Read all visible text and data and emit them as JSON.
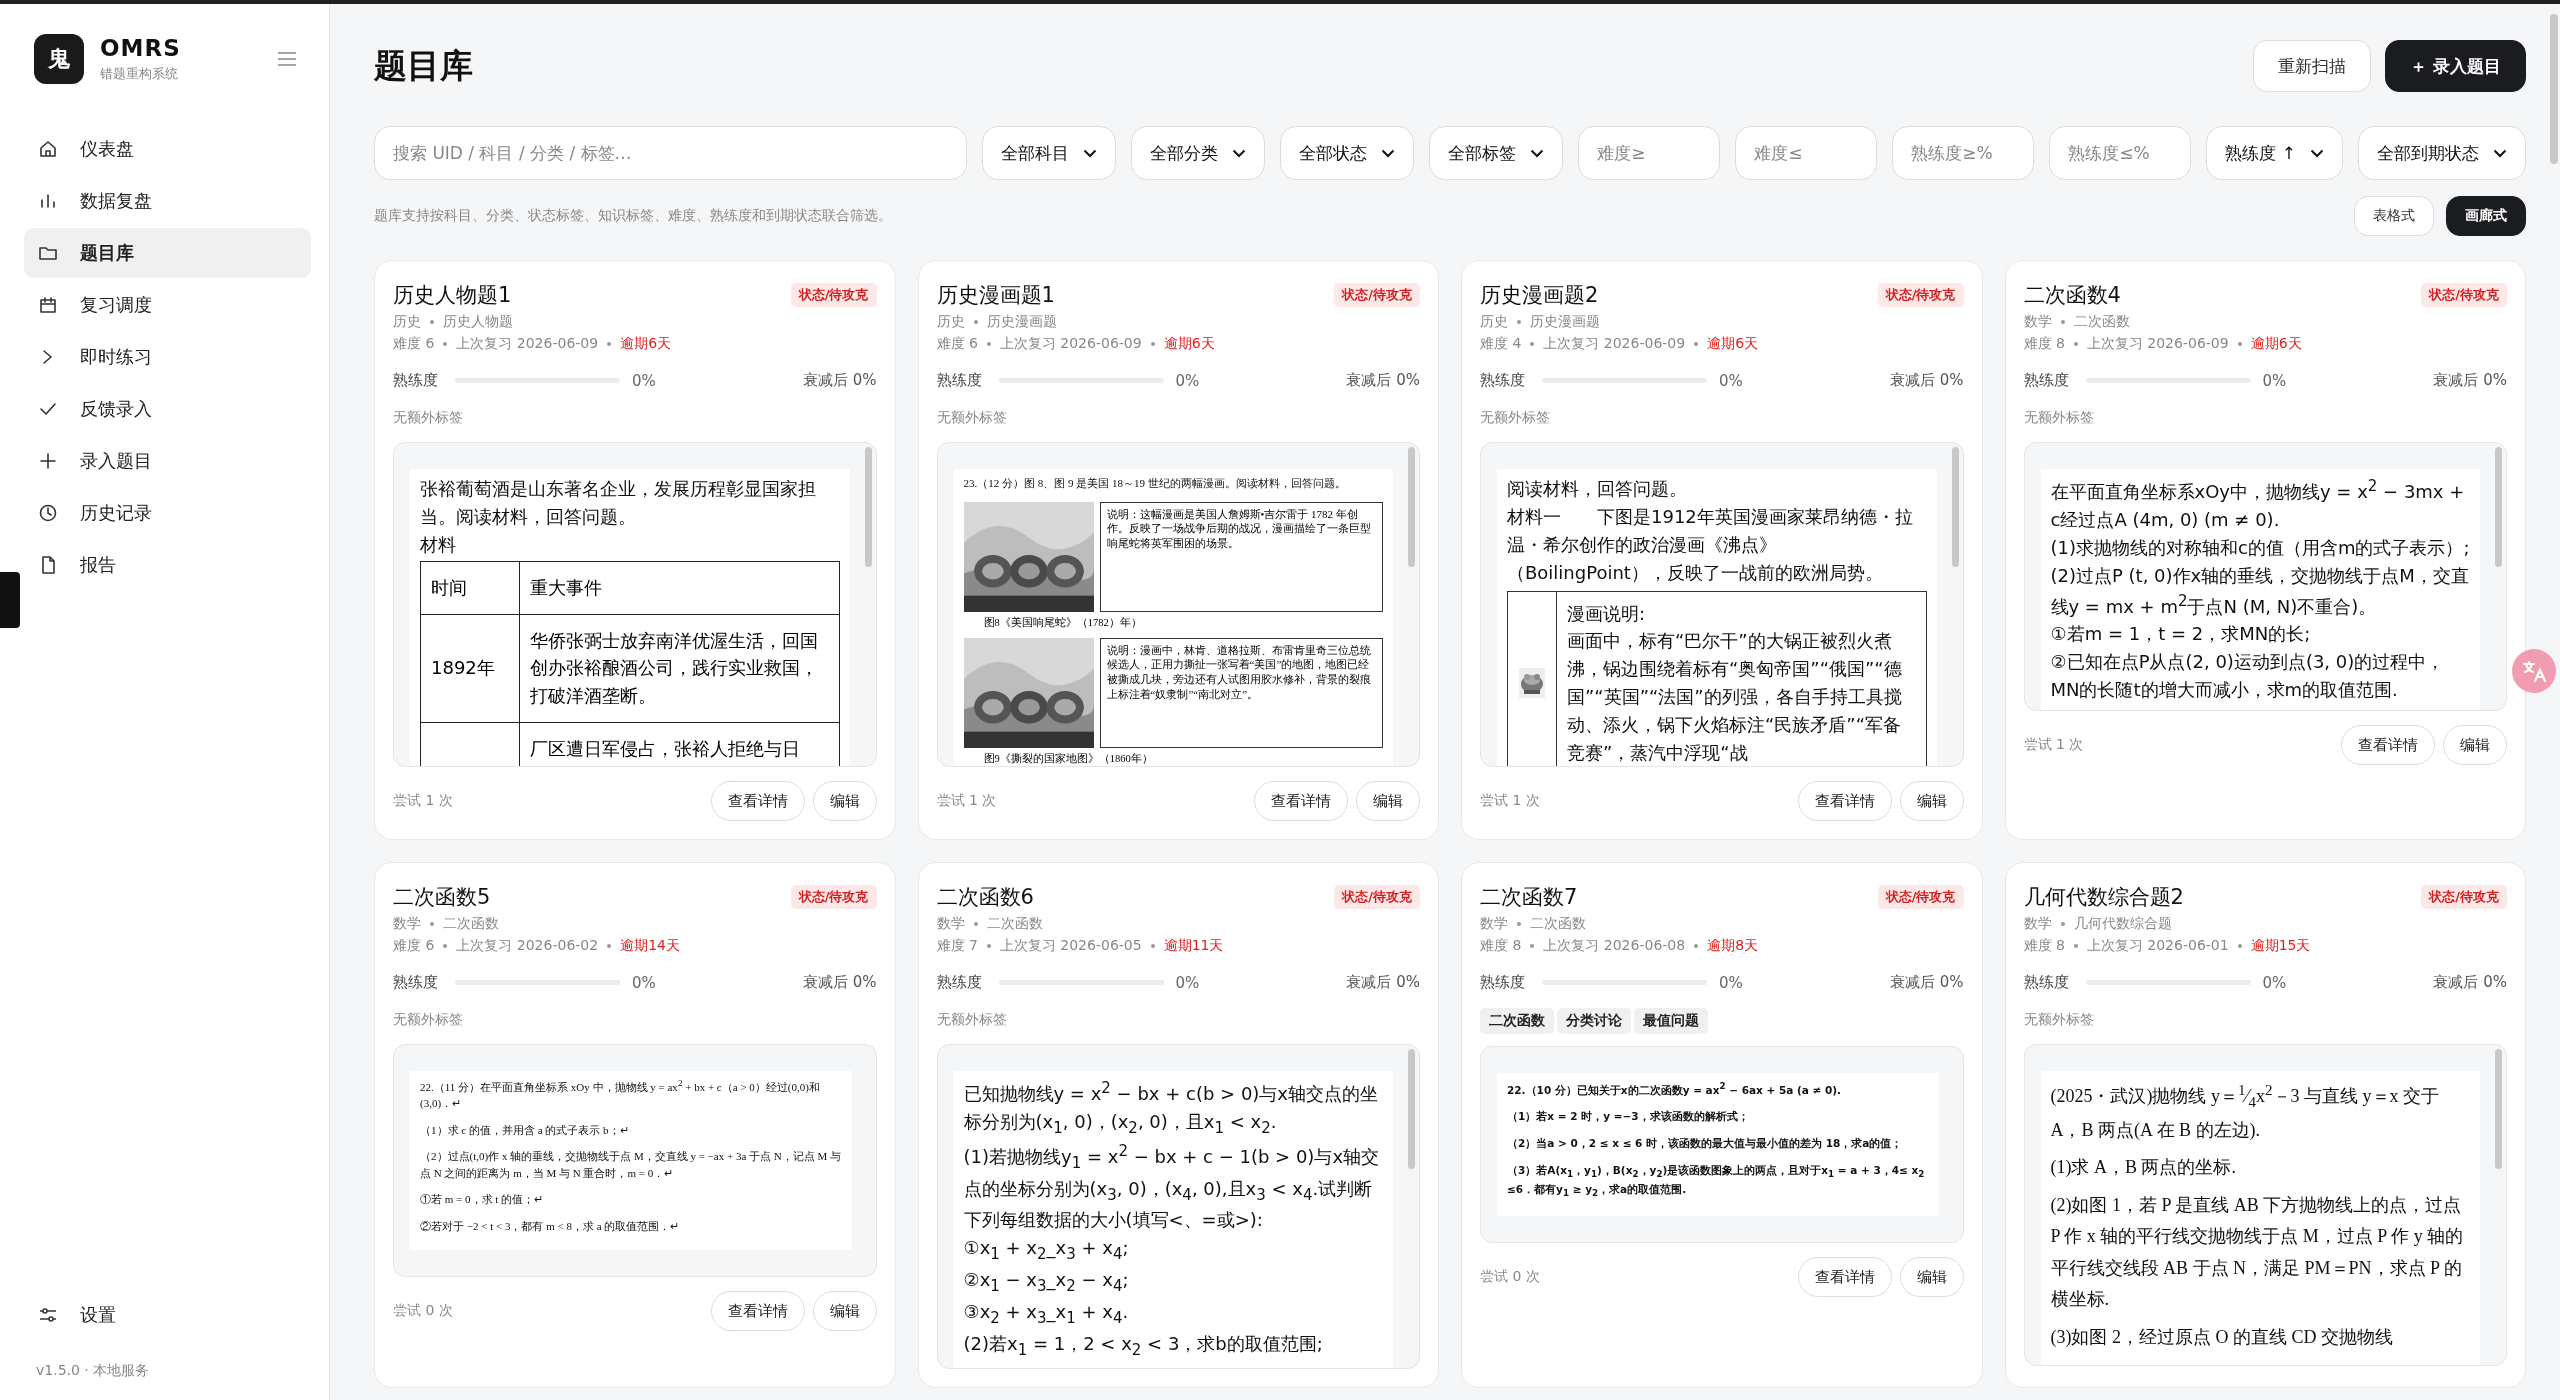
{
  "sidebar": {
    "logo": "鬼",
    "app_name": "OMRS",
    "app_subtitle": "错题重构系统",
    "items": [
      {
        "label": "仪表盘",
        "selected": false
      },
      {
        "label": "数据复盘",
        "selected": false
      },
      {
        "label": "题目库",
        "selected": true
      },
      {
        "label": "复习调度",
        "selected": false
      },
      {
        "label": "即时练习",
        "selected": false
      },
      {
        "label": "反馈录入",
        "selected": false
      },
      {
        "label": "录入题目",
        "selected": false
      },
      {
        "label": "历史记录",
        "selected": false
      },
      {
        "label": "报告",
        "selected": false
      }
    ],
    "settings": "设置",
    "version": "v1.5.0 · 本地服务"
  },
  "header": {
    "title": "题目库",
    "buttons": [
      {
        "label": "重新扫描",
        "kind": "secondary"
      },
      {
        "label": "＋ 录入题目",
        "kind": "primary"
      }
    ]
  },
  "filters": {
    "search": {
      "placeholder": "搜索 UID / 科目 / 分类 / 标签…"
    },
    "controls": [
      {
        "kind": "select",
        "value": "全部科目"
      },
      {
        "kind": "select",
        "value": "全部分类"
      },
      {
        "kind": "select",
        "value": "全部状态"
      },
      {
        "kind": "select",
        "value": "全部标签"
      },
      {
        "kind": "input",
        "placeholder": "难度≥"
      },
      {
        "kind": "input",
        "placeholder": "难度≤"
      },
      {
        "kind": "input",
        "placeholder": "熟练度≥%"
      },
      {
        "kind": "input",
        "placeholder": "熟练度≤%"
      },
      {
        "kind": "select",
        "value": "熟练度 ↑"
      },
      {
        "kind": "select",
        "value": "全部到期状态"
      }
    ]
  },
  "hint": "题库支持按科目、分类、状态标签、知识标签、难度、熟练度和到期状态联合筛选。",
  "view_toggle": [
    {
      "label": "表格式",
      "selected": false
    },
    {
      "label": "画廊式",
      "selected": true
    }
  ],
  "cards": [
    {
      "title": "历史人物题1",
      "badge": "状态/待攻克",
      "subject": "历史",
      "category": "历史人物题",
      "difficulty": "难度 6",
      "last_review": "上次复习 2026-06-09",
      "overdue": "逾期6天",
      "mastery_label": "熟练度",
      "level": 0,
      "mastery": "0%",
      "decayed": "衰减后 0%",
      "no_tags": "无额外标签",
      "preview": {
        "kind": "text",
        "scrollable": true,
        "blocks": [
          {
            "kind": "p",
            "text": "张裕葡萄酒是山东著名企业，发展历程彰显国家担当。阅读材料，回答问题。"
          },
          {
            "kind": "p",
            "text": "材料"
          },
          {
            "kind": "table",
            "rows": [
              [
                "时间",
                "重大事件"
              ],
              [
                "1892年",
                "华侨张弼士放弃南洋优渥生活，回国创办张裕酿酒公司，践行实业救国，打破洋酒垄断。"
              ],
              [
                "",
                "厂区遭日军侵占，张裕人拒绝与日"
              ]
            ]
          }
        ]
      },
      "attempts": "尝试 1 次",
      "actions": [
        "查看详情",
        "编辑"
      ]
    },
    {
      "title": "历史漫画题1",
      "badge": "状态/待攻克",
      "subject": "历史",
      "category": "历史漫画题",
      "difficulty": "难度 6",
      "last_review": "上次复习 2026-06-09",
      "overdue": "逾期6天",
      "mastery_label": "熟练度",
      "level": 0,
      "mastery": "0%",
      "decayed": "衰减后 0%",
      "no_tags": "无额外标签",
      "preview": {
        "kind": "scan",
        "scrollable": true,
        "blocks": [
          {
            "kind": "p",
            "text": "23.（12 分）图 8、图 9 是美国 18～19 世纪的两幅漫画。阅读材料，回答问题。"
          },
          {
            "kind": "figure",
            "note": "说明：这幅漫画是美国人詹姆斯•吉尔雷于 1782 年创作。反映了一场战争后期的战况，漫画描绘了一条巨型响尾蛇将英军围困的场景。",
            "caption": "图8《美国响尾蛇》（1782）年）"
          },
          {
            "kind": "figure",
            "note": "说明：漫画中，林肯、道格拉斯、布雷肯里奇三位总统候选人，正用力撕扯一张写着“美国”的地图，地图已经被撕成几块，旁边还有人试图用胶水修补，背景的裂痕上标注着“奴隶制”“南北对立”。",
            "caption": "图9《撕裂的国家地图》（1860年）"
          }
        ]
      },
      "attempts": "尝试 1 次",
      "actions": [
        "查看详情",
        "编辑"
      ]
    },
    {
      "title": "历史漫画题2",
      "badge": "状态/待攻克",
      "subject": "历史",
      "category": "历史漫画题",
      "difficulty": "难度 4",
      "last_review": "上次复习 2026-06-09",
      "overdue": "逾期6天",
      "mastery_label": "熟练度",
      "level": 0,
      "mastery": "0%",
      "decayed": "衰减后 0%",
      "no_tags": "无额外标签",
      "preview": {
        "kind": "text",
        "scrollable": true,
        "blocks": [
          {
            "kind": "p",
            "text": "阅读材料，回答问题。"
          },
          {
            "kind": "p",
            "text": "材料一　　下图是1912年英国漫画家莱昂纳德・拉温・希尔创作的政治漫画《沸点》（BoilingPoint），反映了一战前的欧洲局势。"
          },
          {
            "kind": "captioned_picture",
            "lines": [
              "漫画说明:",
              "画面中，标有“巴尔干”的大锅正被烈火煮沸，锅边围绕着标有“奥匈帝国”“俄国”“德国”“英国”“法国”的列强，各自手持工具搅动、添火，锅下火焰标注“民族矛盾”“军备竞赛”，蒸汽中浮现“战"
            ]
          }
        ]
      },
      "attempts": "尝试 1 次",
      "actions": [
        "查看详情",
        "编辑"
      ]
    },
    {
      "title": "二次函数4",
      "badge": "状态/待攻克",
      "subject": "数学",
      "category": "二次函数",
      "difficulty": "难度 8",
      "last_review": "上次复习 2026-06-09",
      "overdue": "逾期6天",
      "mastery_label": "熟练度",
      "level": 0,
      "mastery": "0%",
      "decayed": "衰减后 0%",
      "no_tags": "无额外标签",
      "preview": {
        "kind": "text",
        "scrollable": true,
        "blocks": [
          {
            "kind": "p",
            "text": "在平面直角坐标系xOy中，抛物线y = x$^{2}$ − 3mx + c经过点A (4m, 0) (m ≠ 0)."
          },
          {
            "kind": "p",
            "text": "(1)求抛物线的对称轴和c的值（用含m的式子表示）;"
          },
          {
            "kind": "p",
            "text": "(2)过点P (t, 0)作x轴的垂线，交抛物线于点M，交直线y = mx + m$^{2}$于点N (M, N)不重合)。"
          },
          {
            "kind": "p",
            "text": "①若m = 1，t = 2，求MN的长;"
          },
          {
            "kind": "p",
            "text": "②已知在点P从点(2, 0)运动到点(3, 0)的过程中，MN的长随t的增大而减小，求m的取值范围."
          }
        ]
      },
      "attempts": "尝试 1 次",
      "actions": [
        "查看详情",
        "编辑"
      ]
    },
    {
      "title": "二次函数5",
      "badge": "状态/待攻克",
      "subject": "数学",
      "category": "二次函数",
      "difficulty": "难度 6",
      "last_review": "上次复习 2026-06-02",
      "overdue": "逾期14天",
      "mastery_label": "熟练度",
      "level": 0,
      "mastery": "0%",
      "decayed": "衰减后 0%",
      "no_tags": "无额外标签",
      "preview": {
        "kind": "scan",
        "scrollable": false,
        "blocks": [
          {
            "kind": "p",
            "text": "22.（11 分）在平面直角坐标系 xOy 中，抛物线 y = ax$^{2}$ + bx + c（a > 0）经过(0,0)和(3,0)．↵"
          },
          {
            "kind": "p",
            "text": "（1）求 c 的值，并用含 a 的式子表示 b；↵"
          },
          {
            "kind": "p",
            "text": "（2）过点(t,0)作 x 轴的垂线，交抛物线于点 M，交直线 y = −ax + 3a 于点 N，记点 M 与点 N 之间的距离为 m，当 M 与 N 重合时，m = 0．↵"
          },
          {
            "kind": "p",
            "text": "①若 m = 0，求 t 的值；↵"
          },
          {
            "kind": "p",
            "text": "②若对于 −2 < t < 3，都有 m < 8，求 a 的取值范围．↵"
          }
        ]
      },
      "attempts": "尝试 0 次",
      "actions": [
        "查看详情",
        "编辑"
      ]
    },
    {
      "title": "二次函数6",
      "badge": "状态/待攻克",
      "subject": "数学",
      "category": "二次函数",
      "difficulty": "难度 7",
      "last_review": "上次复习 2026-06-05",
      "overdue": "逾期11天",
      "mastery_label": "熟练度",
      "level": 0,
      "mastery": "0%",
      "decayed": "衰减后 0%",
      "no_tags": "无额外标签",
      "preview": {
        "kind": "text",
        "scrollable": true,
        "blocks": [
          {
            "kind": "p",
            "text": "已知抛物线y = x$^{2}$ − bx + c(b > 0)与x轴交点的坐标分别为(x$_{1}$, 0)，(x$_{2}$, 0)，且x$_{1}$ < x$_{2}$."
          },
          {
            "kind": "p",
            "text": "(1)若抛物线y$_{1}$ = x$^{2}$ − bx + c − 1(b > 0)与x轴交点的坐标分别为(x$_{3}$, 0)，(x$_{4}$, 0),且x$_{3}$ < x$_{4}$.试判断下列每组数据的大小(填写<、=或>):"
          },
          {
            "kind": "p",
            "text": "①x$_{1}$ + x$_{2}$_x$_{3}$ + x$_{4}$;"
          },
          {
            "kind": "p",
            "text": "②x$_{1}$ − x$_{3}$_x$_{2}$ − x$_{4}$;"
          },
          {
            "kind": "p",
            "text": "③x$_{2}$ + x$_{3}$_x$_{1}$ + x$_{4}$."
          },
          {
            "kind": "p",
            "text": "(2)若x$_{1}$ = 1，2 < x$_{2}$ < 3，求b的取值范围;"
          }
        ]
      }
    },
    {
      "title": "二次函数7",
      "badge": "状态/待攻克",
      "subject": "数学",
      "category": "二次函数",
      "difficulty": "难度 8",
      "last_review": "上次复习 2026-06-08",
      "overdue": "逾期8天",
      "mastery_label": "熟练度",
      "level": 0,
      "mastery": "0%",
      "decayed": "衰减后 0%",
      "tags": [
        "二次函数",
        "分类讨论",
        "最值问题"
      ],
      "preview": {
        "kind": "scan_bold",
        "scrollable": false,
        "blocks": [
          {
            "kind": "p",
            "text": "22.（10 分）已知关于x的二次函数y = ax$^{2}$ − 6ax + 5a (a ≠ 0)."
          },
          {
            "kind": "p",
            "text": "（1）若x = 2 时，y =−3，求该函数的解析式；"
          },
          {
            "kind": "p",
            "text": "（2）当a > 0，2 ≤ x ≤ 6 时，该函数的最大值与最小值的差为 18，求a的值；"
          },
          {
            "kind": "p",
            "text": "（3）若A(x$_{1}$，y$_{1}$)，B(x$_{2}$，y$_{2}$)是该函数图象上的两点，且对于x$_{1}$ = a + 3，4≤ x$_{2}$ ≤6．都有y$_{1}$ ≥ y$_{2}$，求a的取值范围."
          }
        ]
      },
      "attempts": "尝试 0 次",
      "actions": [
        "查看详情",
        "编辑"
      ]
    },
    {
      "title": "几何代数综合题2",
      "badge": "状态/待攻克",
      "subject": "数学",
      "category": "几何代数综合题",
      "difficulty": "难度 8",
      "last_review": "上次复习 2026-06-01",
      "overdue": "逾期15天",
      "mastery_label": "熟练度",
      "level": 0,
      "mastery": "0%",
      "decayed": "衰减后 0%",
      "no_tags": "无额外标签",
      "preview": {
        "kind": "print",
        "scrollable": true,
        "blocks": [
          {
            "kind": "p",
            "text": "(2025・武汉)抛物线 y＝$^{1}$⁄$_{4}$x$^{2}$－3 与直线 y＝x 交于 A，B 两点(A 在 B 的左边)."
          },
          {
            "kind": "p",
            "text": "(1)求 A，B 两点的坐标."
          },
          {
            "kind": "p",
            "text": "(2)如图 1，若 P 是直线 AB 下方抛物线上的点，过点 P 作 x 轴的平行线交抛物线于点 M，过点 P 作 y 轴的平行线交线段 AB 于点 N，满足 PM＝PN，求点 P 的横坐标."
          },
          {
            "kind": "p",
            "text": "(3)如图 2，经过原点 O 的直线 CD 交抛物线"
          }
        ]
      }
    }
  ]
}
